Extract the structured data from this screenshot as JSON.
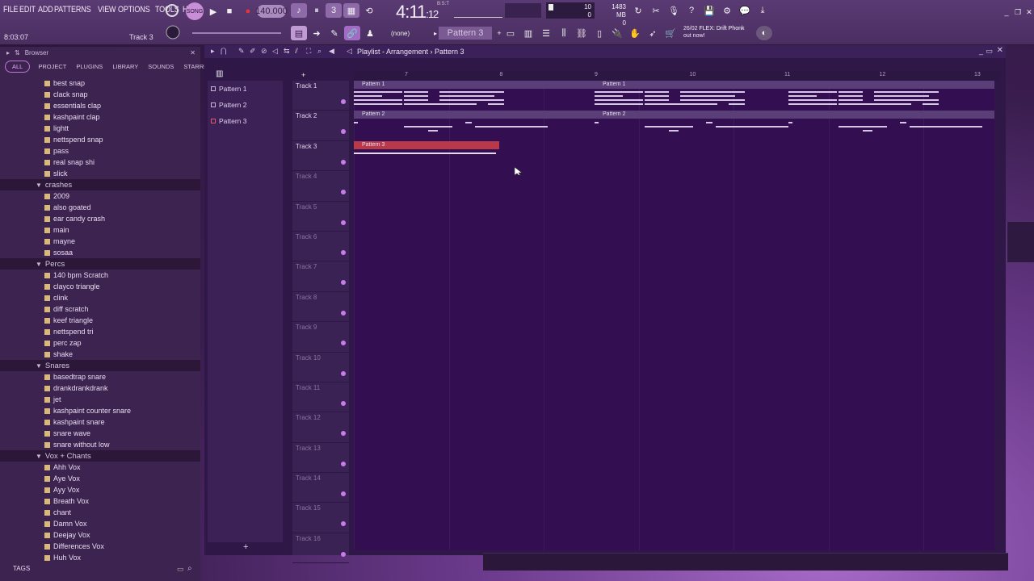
{
  "menu": [
    "FILE",
    "EDIT",
    "ADD",
    "PATTERNS",
    "VIEW",
    "OPTIONS",
    "TOOLS",
    "HELP"
  ],
  "hint": {
    "time": "8:03:07",
    "track": "Track 3"
  },
  "transport": {
    "tempo": "140.000",
    "time_main": "4:11",
    "time_ticks": "12",
    "time_sub": "B:S:T"
  },
  "pattern_selector": {
    "current": "Pattern 3",
    "none": "(none)"
  },
  "monitor": {
    "voices": "10",
    "voices2": "0",
    "memory": "1483 MB",
    "cpu2": "0"
  },
  "news": {
    "date": "26/02",
    "title": "FLEX: Drift Phonk",
    "sub": "out now!"
  },
  "browser": {
    "title": "Browser",
    "tabs": [
      "ALL",
      "PROJECT",
      "PLUGINS",
      "LIBRARY",
      "SOUNDS",
      "STARRED"
    ],
    "rows": [
      {
        "t": "file",
        "label": "best snap"
      },
      {
        "t": "file",
        "label": "clack snap"
      },
      {
        "t": "file",
        "label": "essentials clap"
      },
      {
        "t": "file",
        "label": "kashpaint clap"
      },
      {
        "t": "file",
        "label": "lightt"
      },
      {
        "t": "file",
        "label": "nettspend snap"
      },
      {
        "t": "file",
        "label": "pass"
      },
      {
        "t": "file",
        "label": "real snap shi"
      },
      {
        "t": "file",
        "label": "slick"
      },
      {
        "t": "folder",
        "label": "crashes"
      },
      {
        "t": "file",
        "label": "2009"
      },
      {
        "t": "file",
        "label": "also goated"
      },
      {
        "t": "file",
        "label": "ear candy crash"
      },
      {
        "t": "file",
        "label": "main"
      },
      {
        "t": "file",
        "label": "mayne"
      },
      {
        "t": "file",
        "label": "sosaa"
      },
      {
        "t": "folder",
        "label": "Percs"
      },
      {
        "t": "file",
        "label": "140 bpm Scratch"
      },
      {
        "t": "file",
        "label": "clayco triangle"
      },
      {
        "t": "file",
        "label": "clink"
      },
      {
        "t": "file",
        "label": "diff scratch"
      },
      {
        "t": "file",
        "label": "keef triangle"
      },
      {
        "t": "file",
        "label": "nettspend tri"
      },
      {
        "t": "file",
        "label": "perc zap"
      },
      {
        "t": "file",
        "label": "shake"
      },
      {
        "t": "folder",
        "label": "Snares"
      },
      {
        "t": "file",
        "label": "basedtrap snare"
      },
      {
        "t": "file",
        "label": "drankdrankdrank"
      },
      {
        "t": "file",
        "label": "jet"
      },
      {
        "t": "file",
        "label": "kashpaint counter snare"
      },
      {
        "t": "file",
        "label": "kashpaint snare"
      },
      {
        "t": "file",
        "label": "snare wave"
      },
      {
        "t": "file",
        "label": "snare without low"
      },
      {
        "t": "folder",
        "label": "Vox + Chants"
      },
      {
        "t": "file",
        "label": "Ahh Vox"
      },
      {
        "t": "file",
        "label": "Aye Vox"
      },
      {
        "t": "file",
        "label": "Ayy Vox"
      },
      {
        "t": "file",
        "label": "Breath Vox"
      },
      {
        "t": "file",
        "label": "chant"
      },
      {
        "t": "file",
        "label": "Damn Vox"
      },
      {
        "t": "file",
        "label": "Deejay Vox"
      },
      {
        "t": "file",
        "label": "Differences Vox"
      },
      {
        "t": "file",
        "label": "Huh Vox"
      }
    ],
    "tags": "TAGS"
  },
  "playlist": {
    "breadcrumb": "Playlist - Arrangement › Pattern 3",
    "pattern_list": [
      "Pattern 1",
      "Pattern 2",
      "Pattern 3"
    ],
    "tracks": [
      "Track 1",
      "Track 2",
      "Track 3",
      "Track 4",
      "Track 5",
      "Track 6",
      "Track 7",
      "Track 8",
      "Track 9",
      "Track 10",
      "Track 11",
      "Track 12",
      "Track 13",
      "Track 14",
      "Track 15",
      "Track 16"
    ],
    "bars": [
      "7",
      "8",
      "9",
      "10",
      "11",
      "12",
      "13"
    ],
    "clips": [
      {
        "label": "Pattern 1",
        "track": 0,
        "bar": 0
      },
      {
        "label": "Pattern 1",
        "track": 0,
        "bar": 1
      },
      {
        "label": "Pattern 2",
        "track": 1,
        "bar": 0
      },
      {
        "label": "Pattern 2",
        "track": 1,
        "bar": 1
      },
      {
        "label": "Pattern 3",
        "track": 2,
        "bar": 0,
        "selected": true
      }
    ]
  }
}
